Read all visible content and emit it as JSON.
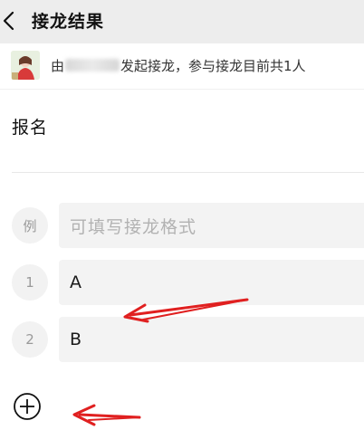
{
  "header": {
    "title": "接龙结果",
    "back_icon": "chevron-left-icon"
  },
  "initiator": {
    "prefix": "由",
    "suffix": "发起接龙，参与接龙目前共1人",
    "avatar": "avatar"
  },
  "form": {
    "signup_label": "报名",
    "example_badge": "例",
    "example_placeholder": "可填写接龙格式",
    "entries": [
      {
        "index": "1",
        "value": "A"
      },
      {
        "index": "2",
        "value": "B"
      }
    ],
    "add_icon": "circle-plus-icon"
  },
  "colors": {
    "header_bg": "#ededed",
    "field_bg": "#f3f3f3",
    "annotation_red": "#e02020"
  }
}
